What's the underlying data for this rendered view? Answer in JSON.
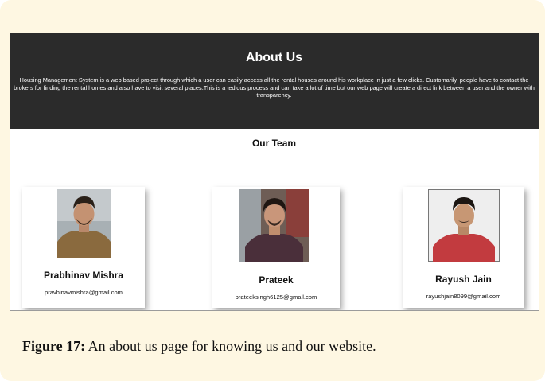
{
  "about": {
    "title": "About Us",
    "description": "Housing Management System is a web based project through which a user can easily access all the rental houses around his workplace in just a few clicks. Customarily, people have to contact the brokers for finding the rental homes and also have to visit several places.This is a tedious process and can take a lot of time but our web page will create a direct link between a user and the owner with transparency."
  },
  "team": {
    "heading": "Our Team",
    "members": [
      {
        "name": "Prabhinav Mishra",
        "email": "pravhinavmishra@gmail.com"
      },
      {
        "name": "Prateek",
        "email": "prateeksingh6125@gmail.com"
      },
      {
        "name": "Rayush Jain",
        "email": "rayushjain8099@gmail.com"
      }
    ]
  },
  "caption": {
    "label": "Figure 17:",
    "text": " An about us page for knowing us and our website."
  },
  "colors": {
    "page_background": "#fef7e2",
    "hero_background": "#2b2b2b"
  }
}
